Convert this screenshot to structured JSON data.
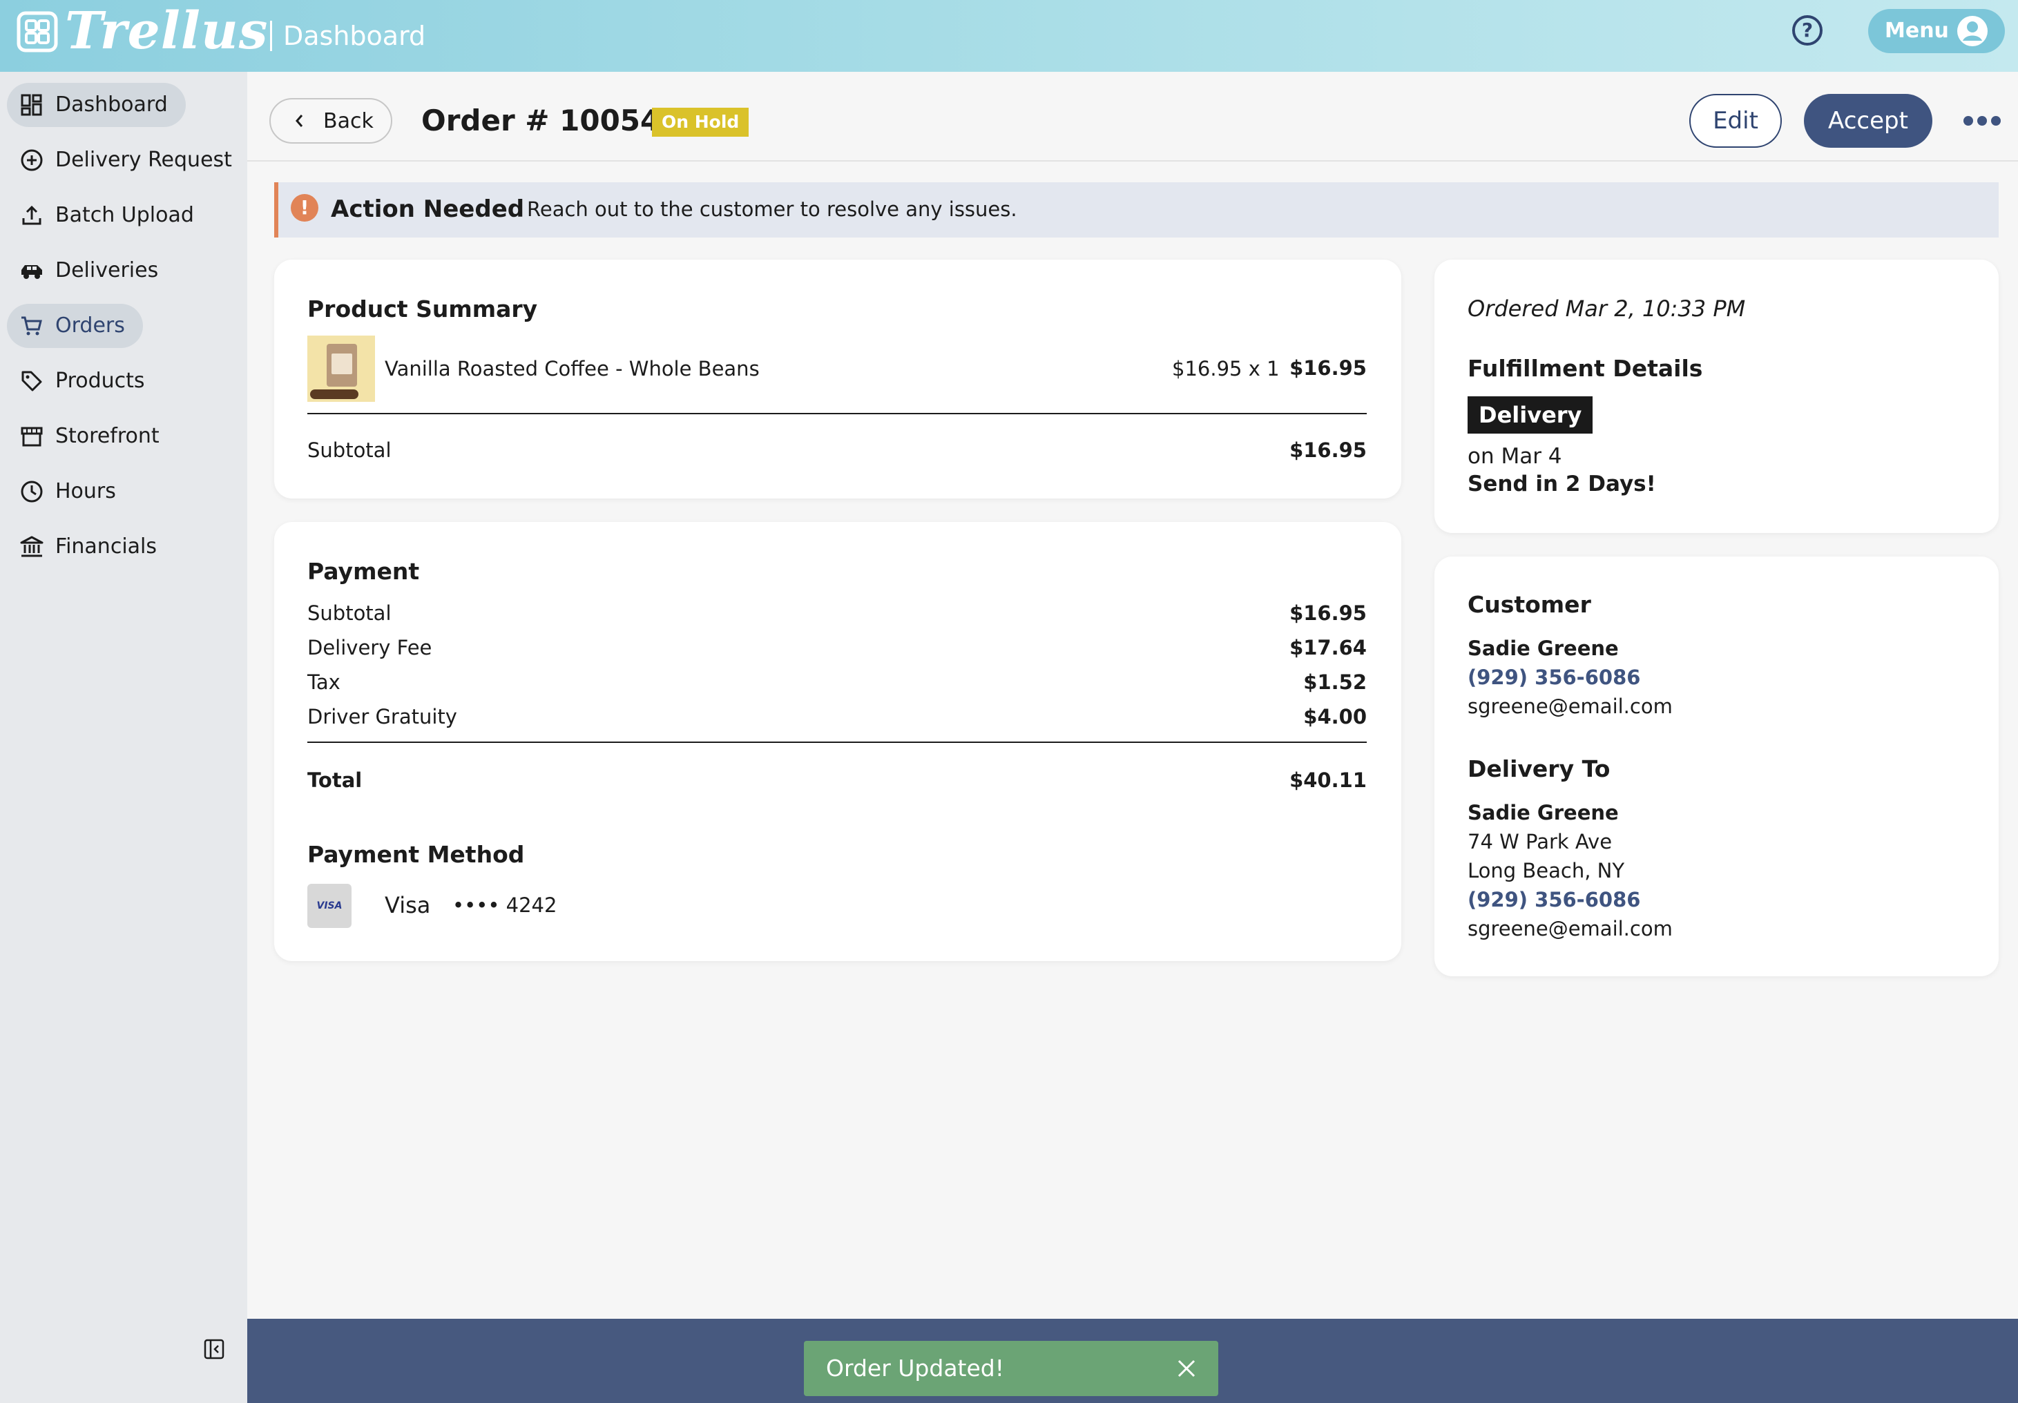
{
  "app": {
    "brand": "Trellus",
    "section": "Dashboard",
    "help_icon": "question-circle-icon",
    "menu_label": "Menu",
    "colors": {
      "topbar_start": "#8ccfdf",
      "primary": "#3f5480",
      "alert_accent": "#e18457",
      "badge_on_hold": "#dac22a",
      "toast_success": "#6ba475",
      "bottombar": "#47597f"
    }
  },
  "sidebar": {
    "items": [
      {
        "label": "Dashboard",
        "icon": "grid-icon"
      },
      {
        "label": "Delivery Request",
        "icon": "plus-circle-icon"
      },
      {
        "label": "Batch Upload",
        "icon": "upload-icon"
      },
      {
        "label": "Deliveries",
        "icon": "car-icon"
      },
      {
        "label": "Orders",
        "icon": "cart-icon"
      },
      {
        "label": "Products",
        "icon": "tag-icon"
      },
      {
        "label": "Storefront",
        "icon": "storefront-icon"
      },
      {
        "label": "Hours",
        "icon": "clock-icon"
      },
      {
        "label": "Financials",
        "icon": "bank-icon"
      }
    ],
    "collapse_icon": "collapse-sidebar-icon"
  },
  "header": {
    "back_label": "Back",
    "order_title": "Order # 10054",
    "status": "On Hold",
    "edit_label": "Edit",
    "accept_label": "Accept",
    "more_icon": "more-horizontal-icon"
  },
  "alert": {
    "title": "Action Needed",
    "message": "Reach out to the customer to resolve any issues."
  },
  "product_summary": {
    "title": "Product Summary",
    "item_name": "Vanilla Roasted Coffee - Whole Beans",
    "unit_qty": "$16.95 x 1",
    "line_total": "$16.95",
    "subtotal_label": "Subtotal",
    "subtotal_value": "$16.95"
  },
  "payment": {
    "title": "Payment",
    "rows": [
      {
        "label": "Subtotal",
        "value": "$16.95"
      },
      {
        "label": "Delivery Fee",
        "value": "$17.64"
      },
      {
        "label": "Tax",
        "value": "$1.52"
      },
      {
        "label": "Driver Gratuity",
        "value": "$4.00"
      }
    ],
    "total_label": "Total",
    "total_value": "$40.11",
    "method_title": "Payment Method",
    "card_logo": "VISA",
    "card_brand": "Visa",
    "card_number": "•••• 4242"
  },
  "fulfillment": {
    "ordered": "Ordered Mar 2, 10:33 PM",
    "title": "Fulfillment Details",
    "type": "Delivery",
    "date": "on Mar 4",
    "note": "Send in 2 Days!"
  },
  "customer": {
    "title": "Customer",
    "name": "Sadie Greene",
    "phone": "(929) 356-6086",
    "email": "sgreene@email.com"
  },
  "delivery_to": {
    "title": "Delivery To",
    "name": "Sadie Greene",
    "street": "74 W Park Ave",
    "city": "Long Beach, NY",
    "phone": "(929) 356-6086",
    "email": "sgreene@email.com"
  },
  "toast": {
    "message": "Order Updated!",
    "close_icon": "close-icon"
  }
}
